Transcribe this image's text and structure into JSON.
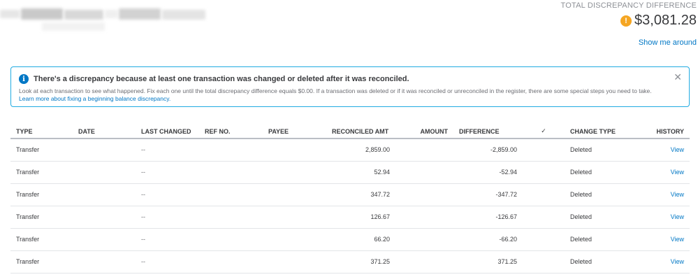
{
  "header": {
    "total_label": "TOTAL DISCREPANCY DIFFERENCE",
    "total_amount": "$3,081.28",
    "warning_icon": "exclamation-circle-icon",
    "warning_color": "#f5a623",
    "show_me_around": "Show me around"
  },
  "alert": {
    "icon": "info-icon",
    "title": "There's a discrepancy because at least one transaction was changed or deleted after it was reconciled.",
    "body": "Look at each transaction to see what happened. Fix each one until the total discrepancy difference equals $0.00. If a transaction was deleted or if it was reconciled or unreconciled in the register, there are some special steps you need to take.",
    "link": "Learn more about fixing a beginning balance discrepancy.",
    "close_glyph": "✕"
  },
  "table": {
    "headers": {
      "type": "TYPE",
      "date": "DATE",
      "last_changed": "LAST CHANGED",
      "ref_no": "REF NO.",
      "payee": "PAYEE",
      "reconciled_amt": "RECONCILED AMT",
      "amount": "AMOUNT",
      "difference": "DIFFERENCE",
      "check": "✓",
      "change_type": "CHANGE TYPE",
      "history": "HISTORY"
    },
    "rows": [
      {
        "type": "Transfer",
        "date": "",
        "last_changed": "--",
        "ref_no": "",
        "payee": "",
        "reconciled_amt": "2,859.00",
        "amount": "",
        "difference": "-2,859.00",
        "check": "",
        "change_type": "Deleted",
        "history": "View"
      },
      {
        "type": "Transfer",
        "date": "",
        "last_changed": "--",
        "ref_no": "",
        "payee": "",
        "reconciled_amt": "52.94",
        "amount": "",
        "difference": "-52.94",
        "check": "",
        "change_type": "Deleted",
        "history": "View"
      },
      {
        "type": "Transfer",
        "date": "",
        "last_changed": "--",
        "ref_no": "",
        "payee": "",
        "reconciled_amt": "347.72",
        "amount": "",
        "difference": "-347.72",
        "check": "",
        "change_type": "Deleted",
        "history": "View"
      },
      {
        "type": "Transfer",
        "date": "",
        "last_changed": "--",
        "ref_no": "",
        "payee": "",
        "reconciled_amt": "126.67",
        "amount": "",
        "difference": "-126.67",
        "check": "",
        "change_type": "Deleted",
        "history": "View"
      },
      {
        "type": "Transfer",
        "date": "",
        "last_changed": "--",
        "ref_no": "",
        "payee": "",
        "reconciled_amt": "66.20",
        "amount": "",
        "difference": "-66.20",
        "check": "",
        "change_type": "Deleted",
        "history": "View"
      },
      {
        "type": "Transfer",
        "date": "",
        "last_changed": "--",
        "ref_no": "",
        "payee": "",
        "reconciled_amt": "371.25",
        "amount": "",
        "difference": "371.25",
        "check": "",
        "change_type": "Deleted",
        "history": "View"
      }
    ]
  }
}
